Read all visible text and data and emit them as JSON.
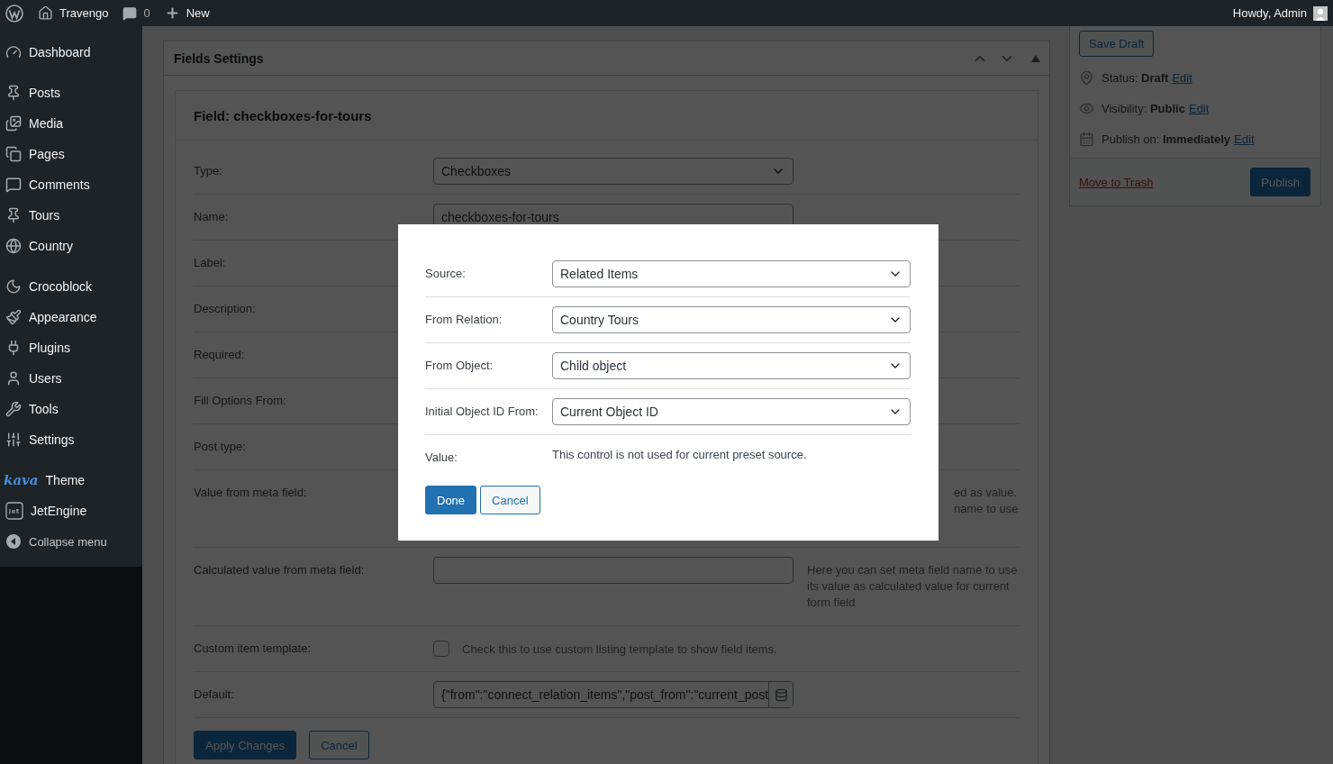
{
  "admin_bar": {
    "site_name": "Travengo",
    "comments_count": "0",
    "new_label": "New",
    "greeting": "Howdy, Admin"
  },
  "sidebar": {
    "groups": [
      [
        {
          "label": "Dashboard",
          "kind": "menu"
        }
      ],
      [
        {
          "label": "Posts",
          "kind": "menu"
        },
        {
          "label": "Media",
          "kind": "menu"
        },
        {
          "label": "Pages",
          "kind": "menu"
        },
        {
          "label": "Comments",
          "kind": "menu"
        },
        {
          "label": "Tours",
          "kind": "menu"
        },
        {
          "label": "Country",
          "kind": "menu"
        }
      ],
      [
        {
          "label": "Crocoblock",
          "kind": "menu"
        },
        {
          "label": "Appearance",
          "kind": "menu"
        },
        {
          "label": "Plugins",
          "kind": "menu"
        },
        {
          "label": "Users",
          "kind": "menu"
        },
        {
          "label": "Tools",
          "kind": "menu"
        },
        {
          "label": "Settings",
          "kind": "menu"
        }
      ],
      [
        {
          "label": "Theme",
          "kind": "theme",
          "logo": "kava"
        },
        {
          "label": "JetEngine",
          "kind": "menu"
        },
        {
          "label": "Collapse menu",
          "kind": "collapse"
        }
      ]
    ]
  },
  "panel": {
    "title": "Fields Settings",
    "field_title": "Field: checkboxes-for-tours",
    "rows": [
      {
        "label": "Type:",
        "kind": "select",
        "value": "Checkboxes"
      },
      {
        "label": "Name:",
        "kind": "text",
        "value": "checkboxes-for-tours"
      },
      {
        "label": "Label:",
        "kind": "covered"
      },
      {
        "label": "Description:",
        "kind": "covered"
      },
      {
        "label": "Required:",
        "kind": "covered"
      },
      {
        "label": "Fill Options From:",
        "kind": "covered"
      },
      {
        "label": "Post type:",
        "kind": "covered"
      },
      {
        "label": "Value from meta field:",
        "kind": "note",
        "description_lines": [
          "ed as value.",
          "name to use"
        ]
      },
      {
        "label": "Calculated value from meta field:",
        "kind": "text",
        "description": "Here you can set meta field name to use its value as calculated value for current form field"
      },
      {
        "label": "Custom item template:",
        "kind": "checkbox",
        "checked": false,
        "description": "Check this to use custom listing template to show field items."
      },
      {
        "label": "Default:",
        "kind": "text_button",
        "value": "{\"from\":\"connect_relation_items\",\"post_from\":\"current_post"
      }
    ],
    "buttons": [
      {
        "label": "Apply Changes",
        "kind": "primary"
      },
      {
        "label": "Cancel",
        "kind": "secondary"
      }
    ]
  },
  "publish": {
    "save_draft": "Save Draft",
    "meta": [
      {
        "text": "Status: **Draft**",
        "link": "Edit"
      },
      {
        "text": "Visibility: **Public**",
        "link": "Edit"
      },
      {
        "text": "Publish on: **Immediately**",
        "link": "Edit"
      }
    ],
    "trash": "Move to Trash",
    "publish": "Publish"
  },
  "modal": {
    "rows": [
      {
        "label": "Source:",
        "kind": "select",
        "value": "Related Items"
      },
      {
        "label": "From Relation:",
        "kind": "select",
        "value": "Country Tours"
      },
      {
        "label": "From Object:",
        "kind": "select",
        "value": "Child object"
      },
      {
        "label": "Initial Object ID From:",
        "kind": "select",
        "value": "Current Object ID"
      },
      {
        "label": "Value:",
        "kind": "note",
        "text": "This control is not used for current preset source."
      }
    ],
    "buttons": [
      {
        "label": "Done",
        "kind": "primary"
      },
      {
        "label": "Cancel",
        "kind": "secondary"
      }
    ]
  }
}
